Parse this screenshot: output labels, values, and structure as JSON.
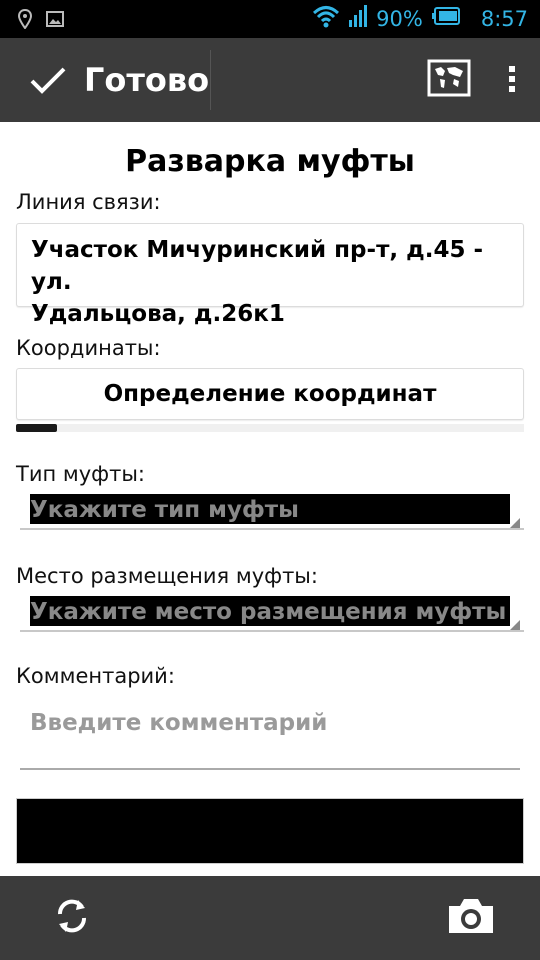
{
  "status_bar": {
    "battery": "90%",
    "time": "8:57",
    "icons": [
      "location-icon",
      "image-icon",
      "wifi-icon",
      "signal-icon",
      "battery-icon"
    ]
  },
  "action_bar": {
    "done_label": "Готово",
    "icons": [
      "check-icon",
      "map-icon",
      "overflow-menu-icon"
    ]
  },
  "form": {
    "title": "Разварка муфты",
    "line_label": "Линия связи:",
    "line_value_1": "Участок Мичуринский пр-т, д.45 - ул.",
    "line_value_2": "Удальцова, д.26к1",
    "coords_label": "Координаты:",
    "coords_button": "Определение координат",
    "coords_progress": 0.08,
    "type_label": "Тип муфты:",
    "type_placeholder": "Укажите тип муфты",
    "place_label": "Место размещения муфты:",
    "place_placeholder": "Укажите место размещения муфты",
    "comment_label": "Комментарий:",
    "comment_placeholder": "Введите комментарий"
  },
  "bottom_bar": {
    "icons": [
      "refresh-icon",
      "camera-icon"
    ]
  },
  "colors": {
    "status_accent": "#33b5e5",
    "bar_background": "#3b3b3b",
    "content_background": "#ffffff"
  }
}
